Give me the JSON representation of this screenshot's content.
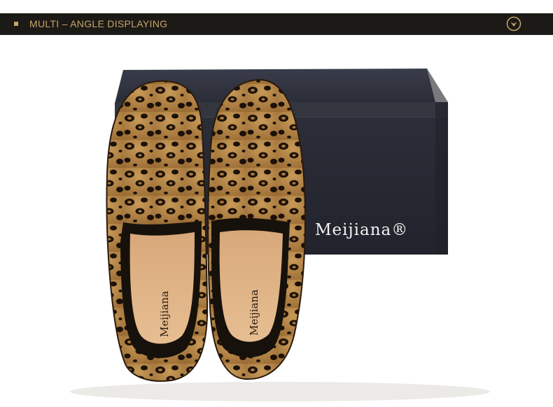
{
  "header": {
    "title": "MULTI – ANGLE DISPLAYING",
    "accent_color": "#c8a46a",
    "bar_color": "#1c1a17",
    "toggle_icon": "chevron-down-circle-icon"
  },
  "product": {
    "box_brand": "Meijiana®",
    "insole_brand": "Meijiana"
  }
}
